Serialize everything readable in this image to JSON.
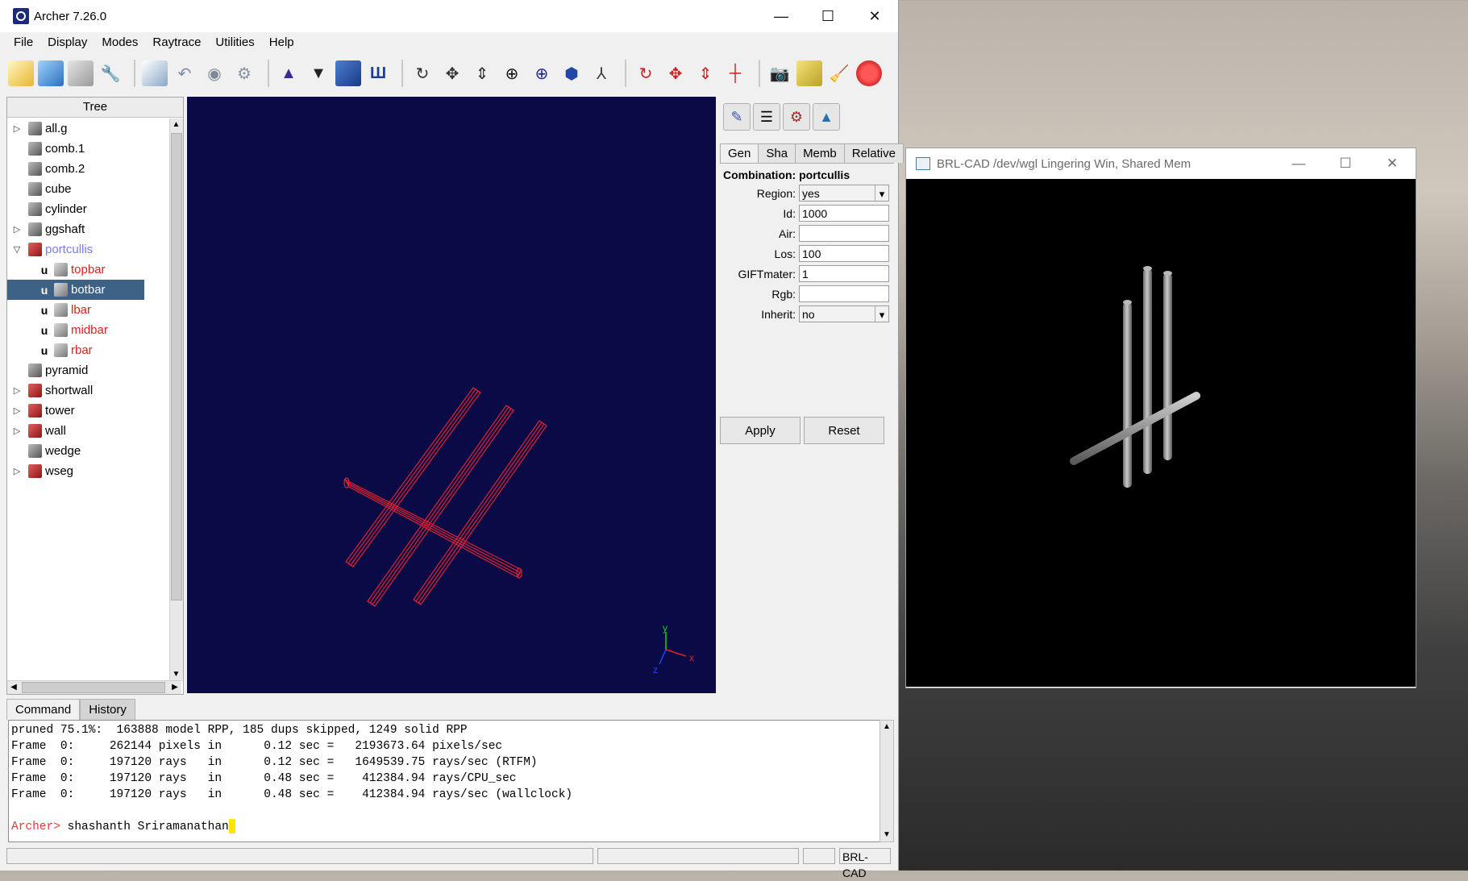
{
  "archer": {
    "title": "Archer 7.26.0",
    "window_controls": [
      "—",
      "☐",
      "✕"
    ],
    "menu": [
      "File",
      "Display",
      "Modes",
      "Raytrace",
      "Utilities",
      "Help"
    ],
    "tree_header": "Tree",
    "tree": [
      {
        "label": "all.g",
        "expander": "▷",
        "icon": "gray",
        "color": "#000000"
      },
      {
        "label": "comb.1",
        "expander": "",
        "icon": "gray",
        "color": "#000000"
      },
      {
        "label": "comb.2",
        "expander": "",
        "icon": "gray",
        "color": "#000000"
      },
      {
        "label": "cube",
        "expander": "",
        "icon": "gray",
        "color": "#000000"
      },
      {
        "label": "cylinder",
        "expander": "",
        "icon": "gray",
        "color": "#000000"
      },
      {
        "label": "ggshaft",
        "expander": "▷",
        "icon": "gray",
        "color": "#000000"
      },
      {
        "label": "portcullis",
        "expander": "▽",
        "icon": "red",
        "color": "#7a7aff"
      },
      {
        "label": "topbar",
        "child": true,
        "u": "u",
        "color": "#e11d1d"
      },
      {
        "label": "botbar",
        "child": true,
        "u": "u",
        "selected": true,
        "color": "#ffffff"
      },
      {
        "label": "lbar",
        "child": true,
        "u": "u",
        "color": "#e11d1d"
      },
      {
        "label": "midbar",
        "child": true,
        "u": "u",
        "color": "#e11d1d"
      },
      {
        "label": "rbar",
        "child": true,
        "u": "u",
        "color": "#e11d1d"
      },
      {
        "label": "pyramid",
        "expander": "",
        "icon": "gray",
        "color": "#000000"
      },
      {
        "label": "shortwall",
        "expander": "▷",
        "icon": "red",
        "color": "#000000"
      },
      {
        "label": "tower",
        "expander": "▷",
        "icon": "red",
        "color": "#000000"
      },
      {
        "label": "wall",
        "expander": "▷",
        "icon": "red",
        "color": "#000000"
      },
      {
        "label": "wedge",
        "expander": "",
        "icon": "gray",
        "color": "#000000"
      },
      {
        "label": "wseg",
        "expander": "▷",
        "icon": "red",
        "color": "#000000"
      }
    ],
    "axes": {
      "x": "x",
      "y": "y",
      "z": "z"
    },
    "attr_tabs": [
      "Gen",
      "Sha",
      "Memb",
      "Relative"
    ],
    "combination_title": "Combination: portcullis",
    "fields": {
      "region_label": "Region:",
      "region_value": "yes",
      "id_label": "Id:",
      "id_value": "1000",
      "air_label": "Air:",
      "air_value": "",
      "los_label": "Los:",
      "los_value": "100",
      "giftmater_label": "GIFTmater:",
      "giftmater_value": "1",
      "rgb_label": "Rgb:",
      "rgb_value": "",
      "inherit_label": "Inherit:",
      "inherit_value": "no"
    },
    "apply_label": "Apply",
    "reset_label": "Reset",
    "cmd_tabs": [
      "Command",
      "History"
    ],
    "console_lines": [
      "pruned 75.1%:  163888 model RPP, 185 dups skipped, 1249 solid RPP",
      "Frame  0:     262144 pixels in      0.12 sec =   2193673.64 pixels/sec",
      "Frame  0:     197120 rays   in      0.12 sec =   1649539.75 rays/sec (RTFM)",
      "Frame  0:     197120 rays   in      0.48 sec =    412384.94 rays/CPU_sec",
      "Frame  0:     197120 rays   in      0.48 sec =    412384.94 rays/sec (wallclock)"
    ],
    "prompt": "Archer>",
    "command_input": " shashanth Sriramanathan",
    "status_right": "BRL-CAD"
  },
  "brl": {
    "title": "BRL-CAD /dev/wgl Lingering Win, Shared Mem",
    "window_controls": [
      "—",
      "☐",
      "✕"
    ]
  },
  "colors": {
    "wireframe": "#e0212c",
    "viewport_bg": "#0a0a47",
    "selection": "#3d6285"
  }
}
